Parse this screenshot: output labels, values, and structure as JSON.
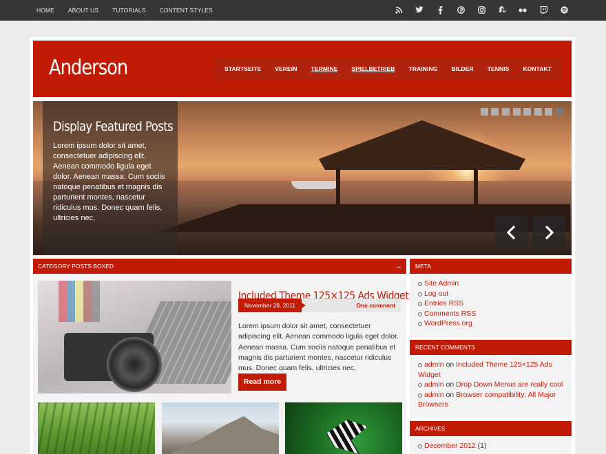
{
  "topnav": {
    "items": [
      "HOME",
      "ABOUT US",
      "TUTORIALS",
      "CONTENT STYLES"
    ]
  },
  "social_icons": [
    "rss-icon",
    "twitter-icon",
    "facebook-icon",
    "pinterest-icon",
    "instagram-icon",
    "stumbleupon-icon",
    "flickr-icon",
    "twitch-icon",
    "spotify-icon"
  ],
  "header": {
    "site_title": "Anderson",
    "nav": [
      "STARTSEITE",
      "VEREIN",
      "TERMINE",
      "SPIELBETRIEB",
      "TRAINING",
      "BILDER",
      "TENNIS",
      "KONTAKT"
    ]
  },
  "slider": {
    "title": "Display Featured Posts",
    "text": "Lorem ipsum dolor sit amet, consectetuer adipiscing elit. Aenean commodo ligula eget dolor. Aenean massa. Cum sociis natoque penatibus et magnis dis parturient montes, nascetur ridiculus mus. Donec quam felis, ultricies nec,",
    "slide_count": 8,
    "active_slide": 8
  },
  "category": {
    "heading": "CATEGORY POSTS BOXED",
    "arrow": "→",
    "post": {
      "title": "Included Theme 125×125 Ads Widget",
      "date": "November 28, 2011",
      "comments": "One comment",
      "excerpt": "Lorem ipsum dolor sit amet, consectetuer adipiscing elit. Aenean commodo ligula eget dolor. Aenean massa. Cum sociis natoque penatibus et magnis dis parturient montes, nascetur ridiculus mus. Donec quam felis, ultricies nec,",
      "read_more": "Read more"
    }
  },
  "sidebar": {
    "meta": {
      "heading": "META",
      "links": [
        "Site Admin",
        "Log out",
        "Entries RSS",
        "Comments RSS",
        "WordPress.org"
      ]
    },
    "recent_comments": {
      "heading": "RECENT COMMENTS",
      "items": [
        {
          "author": "admin",
          "on": "on",
          "post": "Included Theme 125×125 Ads Widget"
        },
        {
          "author": "admin",
          "on": "on",
          "post": "Drop Down Menus are really cool"
        },
        {
          "author": "admin",
          "on": "on",
          "post": "Browser compatibility: All Major Browsers"
        }
      ]
    },
    "archives": {
      "heading": "ARCHIVES",
      "items": [
        {
          "label": "December 2012",
          "count": "(1)"
        }
      ]
    }
  },
  "colors": {
    "brand_red": "#c11a05",
    "topbar": "#363636"
  }
}
